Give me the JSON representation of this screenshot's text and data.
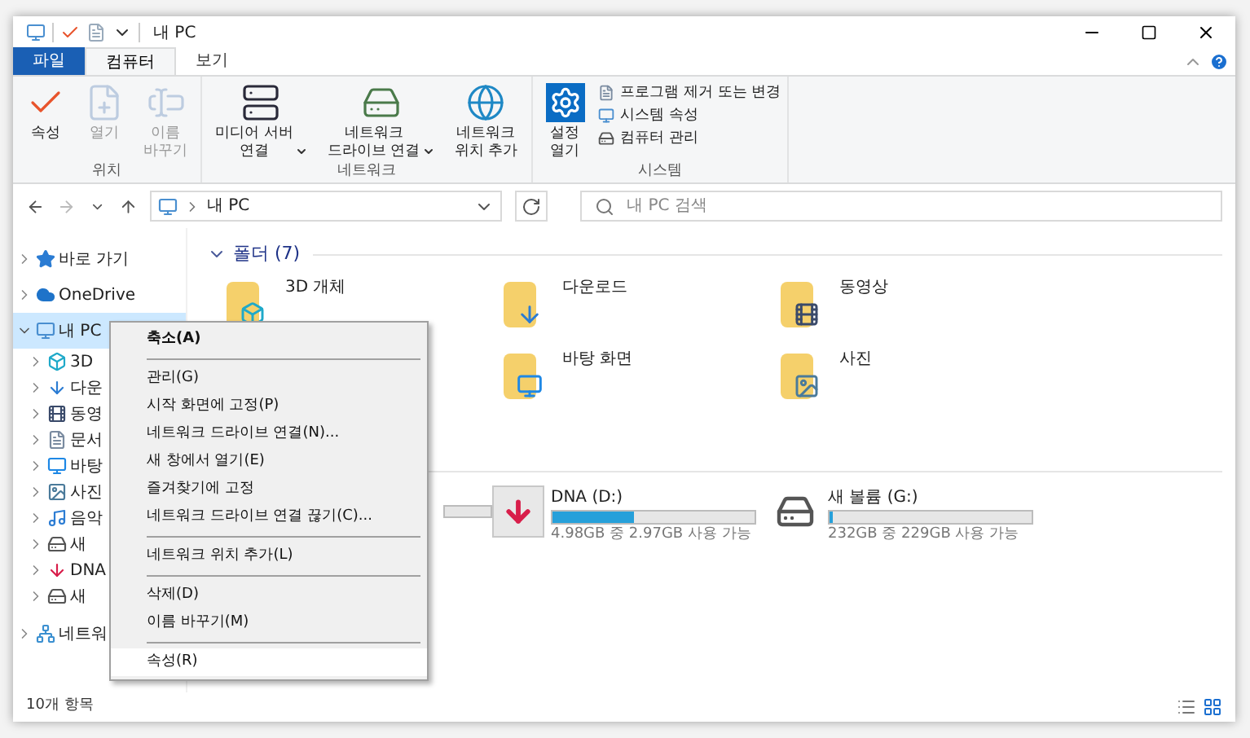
{
  "window": {
    "title": "내 PC"
  },
  "ribbon_tabs": [
    {
      "label": "파일",
      "kind": "file",
      "selected": false
    },
    {
      "label": "컴퓨터",
      "kind": "tab",
      "selected": true
    },
    {
      "label": "보기",
      "kind": "tab",
      "selected": false
    }
  ],
  "ribbon_groups": [
    {
      "name": "위치",
      "buttons": [
        {
          "label": "속성",
          "disabled": false
        },
        {
          "label": "열기",
          "disabled": true
        },
        {
          "label": "이름\n바꾸기",
          "disabled": true
        }
      ]
    },
    {
      "name": "네트워크",
      "buttons": [
        {
          "label": "미디어 서버\n연결",
          "dropdown": true
        },
        {
          "label": "네트워크\n드라이브 연결",
          "dropdown": true
        },
        {
          "label": "네트워크\n위치 추가",
          "dropdown": false
        }
      ]
    },
    {
      "name": "시스템",
      "buttons": [
        {
          "label": "설정\n열기",
          "dropdown": false
        }
      ],
      "small": [
        "프로그램 제거 또는 변경",
        "시스템 속성",
        "컴퓨터 관리"
      ]
    }
  ],
  "address": {
    "path": "내 PC",
    "search_placeholder": "내 PC 검색"
  },
  "nav": [
    {
      "label": "바로 가기",
      "selected": false,
      "expanded": false
    },
    {
      "label": "OneDrive",
      "selected": false,
      "expanded": false
    },
    {
      "label": "내 PC",
      "selected": true,
      "expanded": true,
      "children": [
        {
          "label": "3D"
        },
        {
          "label": "다운"
        },
        {
          "label": "동영"
        },
        {
          "label": "문서"
        },
        {
          "label": "바탕"
        },
        {
          "label": "사진"
        },
        {
          "label": "음악"
        },
        {
          "label": "새"
        },
        {
          "label": "DNA"
        },
        {
          "label": "새"
        }
      ]
    },
    {
      "label": "네트워",
      "selected": false,
      "expanded": false
    }
  ],
  "folders": {
    "header": "폴더 (7)",
    "items": [
      {
        "label": "3D 개체"
      },
      {
        "label": "다운로드"
      },
      {
        "label": "동영상"
      },
      {
        "label": "바탕 화면"
      },
      {
        "label": "사진"
      }
    ]
  },
  "drives": [
    {
      "kind": "hidden"
    },
    {
      "kind": "removable",
      "name": "DNA (D:)",
      "level": 0.4,
      "free": "4.98GB 중 2.97GB 사용 가능"
    },
    {
      "kind": "disk",
      "name": "새 볼륨 (G:)",
      "level": 0.013,
      "free": "232GB 중 229GB 사용 가능"
    }
  ],
  "context_menu": [
    {
      "kind": "item",
      "label": "축소(A)",
      "bold": true,
      "selected": false
    },
    {
      "kind": "separator"
    },
    {
      "kind": "item",
      "label": "관리(G)",
      "bold": false,
      "selected": false
    },
    {
      "kind": "item",
      "label": "시작 화면에 고정(P)",
      "bold": false,
      "selected": false
    },
    {
      "kind": "item",
      "label": "네트워크 드라이브 연결(N)...",
      "bold": false,
      "selected": false
    },
    {
      "kind": "item",
      "label": "새 창에서 열기(E)",
      "bold": false,
      "selected": false
    },
    {
      "kind": "item",
      "label": "즐겨찾기에 고정",
      "bold": false,
      "selected": false
    },
    {
      "kind": "item",
      "label": "네트워크 드라이브 연결 끊기(C)...",
      "bold": false,
      "selected": false
    },
    {
      "kind": "separator"
    },
    {
      "kind": "item",
      "label": "네트워크 위치 추가(L)",
      "bold": false,
      "selected": false
    },
    {
      "kind": "separator"
    },
    {
      "kind": "item",
      "label": "삭제(D)",
      "bold": false,
      "selected": false
    },
    {
      "kind": "item",
      "label": "이름 바꾸기(M)",
      "bold": false,
      "selected": false
    },
    {
      "kind": "separator"
    },
    {
      "kind": "item",
      "label": "속성(R)",
      "bold": false,
      "selected": true
    }
  ],
  "status_bar": {
    "count": "10개 항목"
  }
}
